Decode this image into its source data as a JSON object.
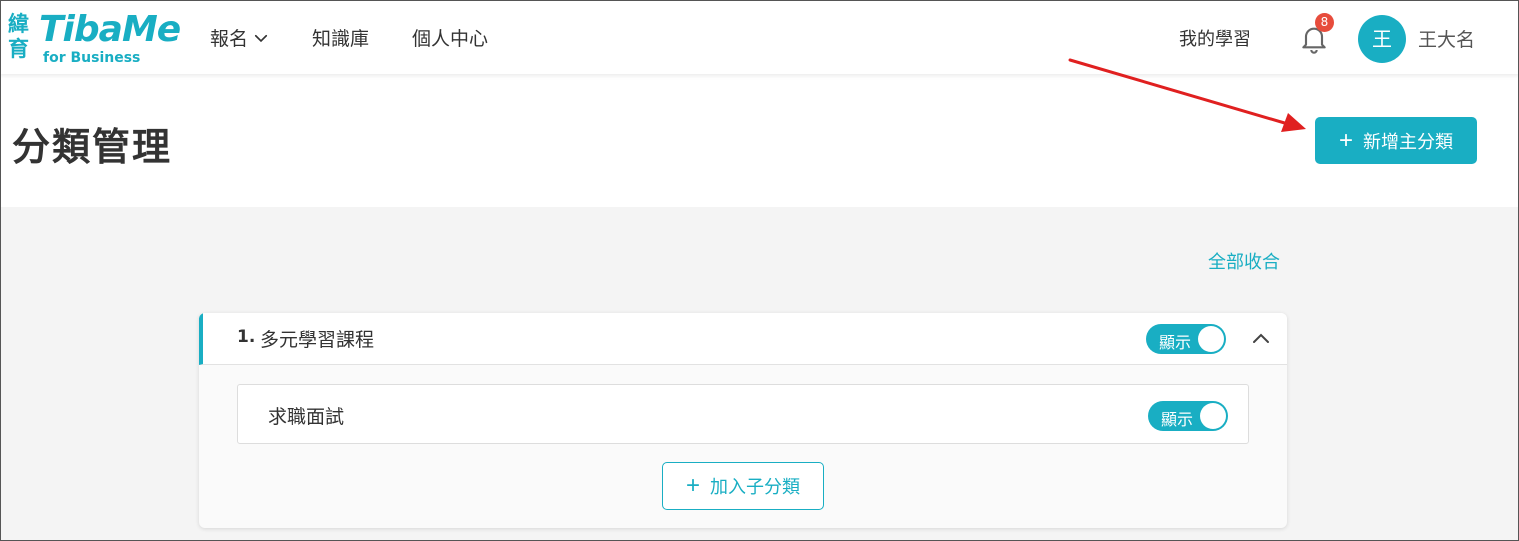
{
  "header": {
    "logo": {
      "cjk": "緯育",
      "brand": "TibaMe",
      "sub": "for Business"
    },
    "nav": [
      {
        "label": "報名",
        "has_dropdown": true
      },
      {
        "label": "知識庫"
      },
      {
        "label": "個人中心"
      }
    ],
    "my_learning": "我的學習",
    "notification_count": "8",
    "avatar_initial": "王",
    "username": "王大名"
  },
  "page": {
    "title": "分類管理",
    "add_main_category": "新增主分類",
    "collapse_all": "全部收合"
  },
  "categories": [
    {
      "index": "1.",
      "name": "多元學習課程",
      "toggle_label": "顯示",
      "visible": true,
      "expanded": true,
      "subcategories": [
        {
          "name": "求職面試",
          "toggle_label": "顯示",
          "visible": true
        }
      ],
      "add_sub_label": "加入子分類"
    }
  ],
  "colors": {
    "accent": "#19aec3",
    "badge": "#e74c3c",
    "annotation_arrow": "#e02020"
  },
  "icons": [
    "chevron-down-icon",
    "bell-icon",
    "plus-icon",
    "chevron-up-icon"
  ]
}
